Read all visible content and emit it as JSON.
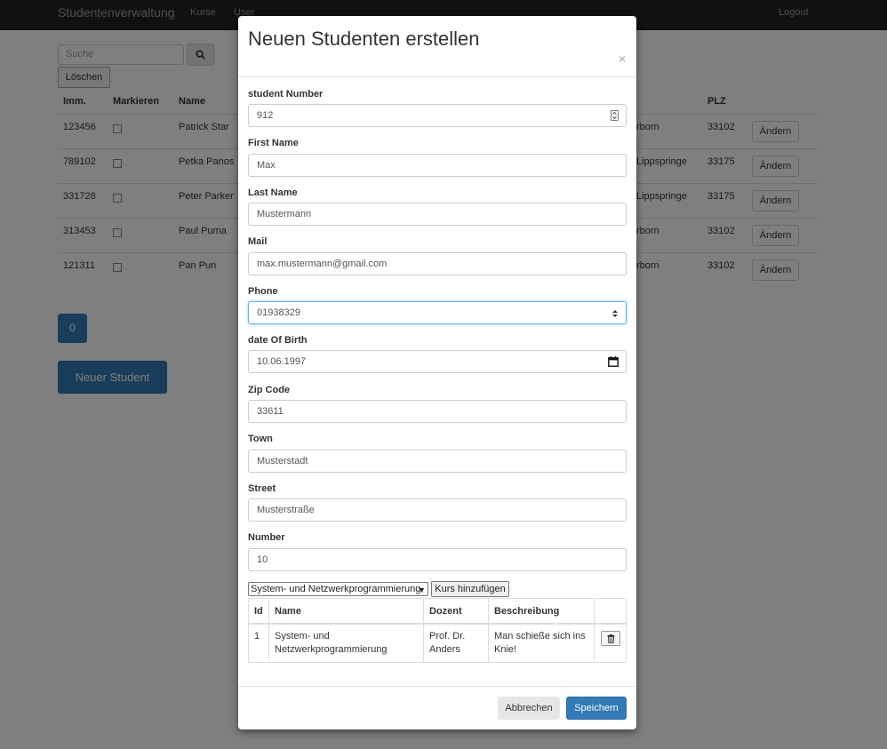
{
  "navbar": {
    "brand": "Studentenverwaltung",
    "links": [
      "Kurse",
      "User"
    ],
    "logout": "Logout"
  },
  "page": {
    "search_placeholder": "Suche",
    "delete_label": "Löschen",
    "table": {
      "headers": [
        "Imm.",
        "Markieren",
        "Name",
        "PLZ"
      ],
      "rows": [
        {
          "imm": "123456",
          "name": "Patrick Star",
          "town": "rborn",
          "plz": "33102",
          "action": "Ändern"
        },
        {
          "imm": "789102",
          "name": "Petka Panos",
          "town": "Lippspringe",
          "plz": "33175",
          "action": "Ändern"
        },
        {
          "imm": "331728",
          "name": "Peter Parker",
          "town": "Lippspringe",
          "plz": "33175",
          "action": "Ändern"
        },
        {
          "imm": "313453",
          "name": "Paul Puma",
          "town": "rborn",
          "plz": "33102",
          "action": "Ändern"
        },
        {
          "imm": "121311",
          "name": "Pan Pun",
          "town": "rborn",
          "plz": "33102",
          "action": "Ändern"
        }
      ]
    },
    "page_number": "0",
    "new_student_label": "Neuer Student"
  },
  "modal": {
    "title": "Neuen Studenten erstellen",
    "close": "×",
    "fields": [
      {
        "label": "student Number",
        "value": "912"
      },
      {
        "label": "First Name",
        "value": "Max"
      },
      {
        "label": "Last Name",
        "value": "Mustermann"
      },
      {
        "label": "Mail",
        "value": "max.mustermann@gmail.com"
      },
      {
        "label": "Phone",
        "value": "01938329"
      },
      {
        "label": "date Of Birth",
        "value": "10.06.1997"
      },
      {
        "label": "Zip Code",
        "value": "33611"
      },
      {
        "label": "Town",
        "value": "Musterstadt"
      },
      {
        "label": "Street",
        "value": "Musterstraße"
      },
      {
        "label": "Number",
        "value": "10"
      }
    ],
    "course_select": "System- und Netzwerkprogrammierung",
    "add_course_label": "Kurs hinzufügen",
    "course_table": {
      "headers": [
        "Id",
        "Name",
        "Dozent",
        "Beschreibung"
      ],
      "rows": [
        {
          "id": "1",
          "name": "System- und Netzwerkprogrammierung",
          "dozent": "Prof. Dr. Anders",
          "beschreibung": "Man schieße sich ins Knie!"
        }
      ]
    },
    "cancel_label": "Abbrechen",
    "save_label": "Speichern"
  },
  "colors": {
    "primary": "#337ab7",
    "navbar": "#222222",
    "focus": "#66afe9"
  }
}
